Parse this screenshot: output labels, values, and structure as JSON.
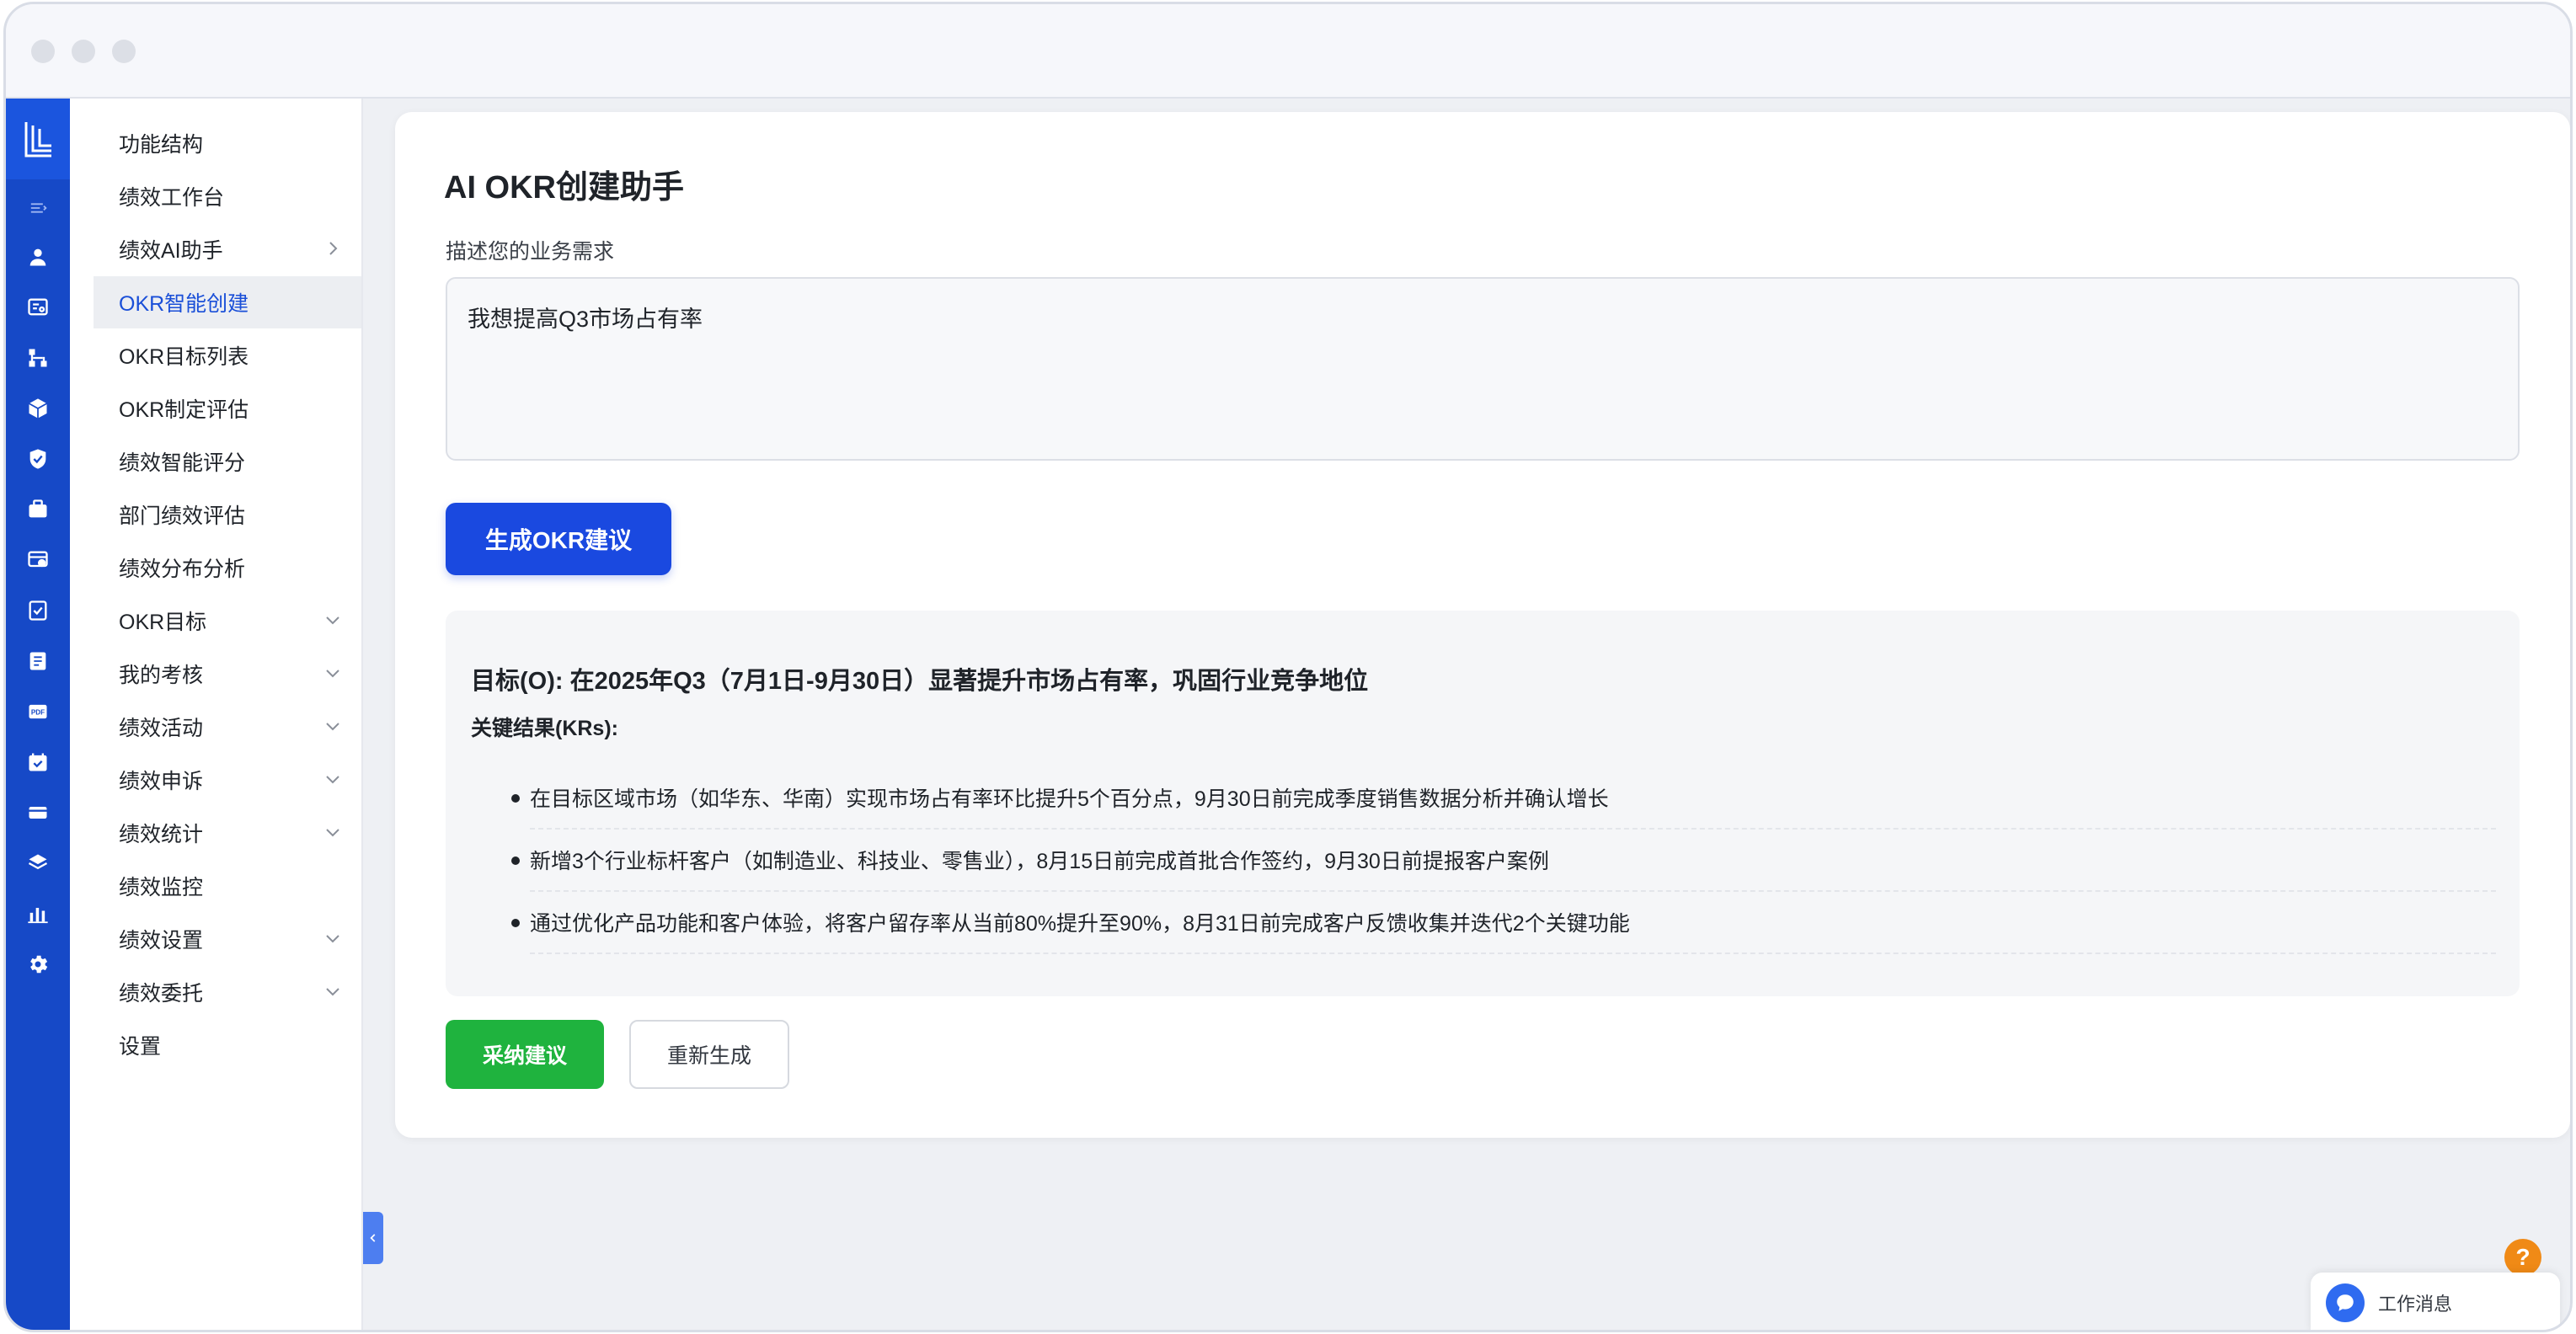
{
  "window": {
    "nav_items": [
      {
        "label": "功能结构"
      },
      {
        "label": "绩效工作台"
      },
      {
        "label": "绩效AI助手",
        "chevron": "right"
      },
      {
        "label": "OKR智能创建",
        "active": true
      },
      {
        "label": "OKR目标列表"
      },
      {
        "label": "OKR制定评估"
      },
      {
        "label": "绩效智能评分"
      },
      {
        "label": "部门绩效评估"
      },
      {
        "label": "绩效分布分析"
      },
      {
        "label": "OKR目标",
        "chevron": "down"
      },
      {
        "label": "我的考核",
        "chevron": "down"
      },
      {
        "label": "绩效活动",
        "chevron": "down"
      },
      {
        "label": "绩效申诉",
        "chevron": "down"
      },
      {
        "label": "绩效统计",
        "chevron": "down"
      },
      {
        "label": "绩效监控"
      },
      {
        "label": "绩效设置",
        "chevron": "down"
      },
      {
        "label": "绩效委托",
        "chevron": "down"
      },
      {
        "label": "设置"
      }
    ],
    "rail_icons": [
      "logo-icon",
      "menu-toggle-icon",
      "user-icon",
      "report-search-icon",
      "org-chart-icon",
      "cube-icon",
      "shield-check-icon",
      "briefcase-icon",
      "settings-panel-icon",
      "checklist-icon",
      "book-icon",
      "pdf-icon",
      "calendar-check-icon",
      "card-icon",
      "layers-icon",
      "bar-chart-icon",
      "gear-icon"
    ]
  },
  "main": {
    "title": "AI OKR创建助手",
    "field_label": "描述您的业务需求",
    "input_value": "我想提高Q3市场占有率",
    "generate_label": "生成OKR建议",
    "objective": "目标(O): 在2025年Q3（7月1日-9月30日）显著提升市场占有率，巩固行业竞争地位",
    "kr_heading": "关键结果(KRs):",
    "key_results": [
      "在目标区域市场（如华东、华南）实现市场占有率环比提升5个百分点，9月30日前完成季度销售数据分析并确认增长",
      "新增3个行业标杆客户（如制造业、科技业、零售业），8月15日前完成首批合作签约，9月30日前提报客户案例",
      "通过优化产品功能和客户体验，将客户留存率从当前80%提升至90%，8月31日前完成客户反馈收集并迭代2个关键功能"
    ],
    "accept_label": "采纳建议",
    "regenerate_label": "重新生成"
  },
  "floating": {
    "help_symbol": "?",
    "messages_label": "工作消息"
  },
  "colors": {
    "rail": "#1649c7",
    "primary": "#1a49e0",
    "accept": "#1fb33e",
    "active_text": "#1a4fd8",
    "help": "#f08a16"
  }
}
